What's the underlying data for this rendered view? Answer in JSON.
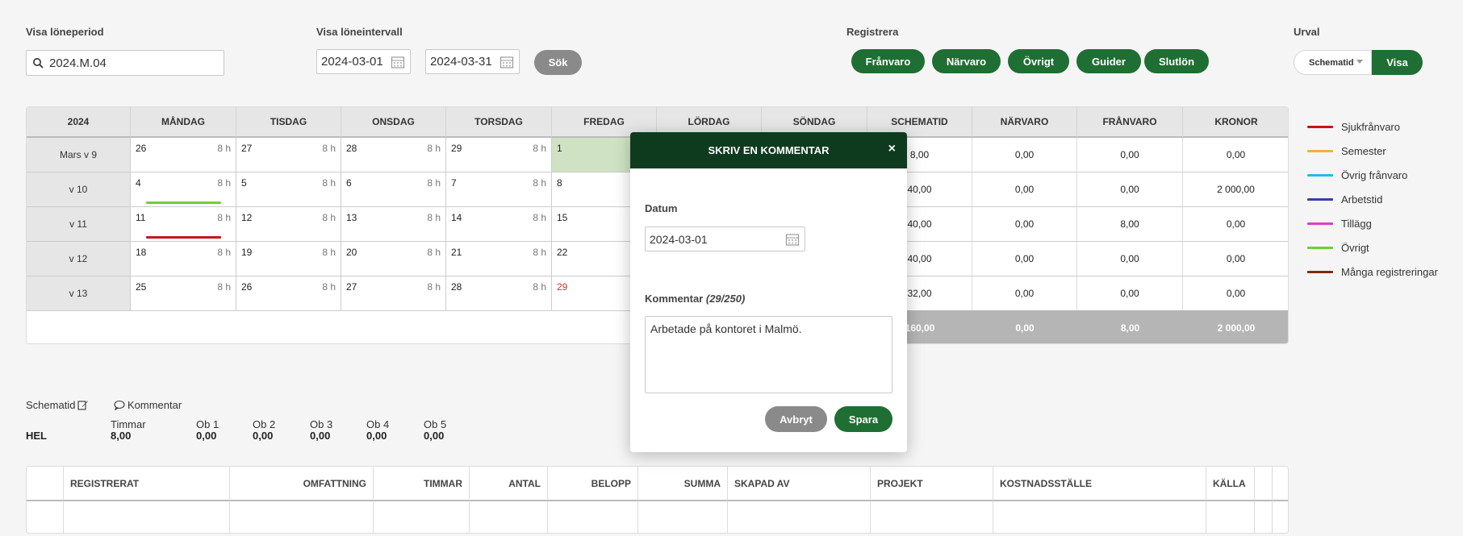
{
  "filters": {
    "loneperiod_label": "Visa löneperiod",
    "loneperiod_value": "2024.M.04",
    "loneintervall_label": "Visa löneintervall",
    "date_from": "2024-03-01",
    "date_to": "2024-03-31",
    "search_label": "Sök"
  },
  "register": {
    "label": "Registrera",
    "buttons": [
      "Frånvaro",
      "Närvaro",
      "Övrigt",
      "Guider",
      "Slutlön"
    ]
  },
  "urval": {
    "label": "Urval",
    "select_value": "Schematid",
    "show_label": "Visa"
  },
  "calendar": {
    "year": "2024",
    "days": [
      "MÅNDAG",
      "TISDAG",
      "ONSDAG",
      "TORSDAG",
      "FREDAG",
      "LÖRDAG",
      "SÖNDAG"
    ],
    "sum_headers": [
      "SCHEMATID",
      "NÄRVARO",
      "FRÅNVARO",
      "KRONOR"
    ],
    "weeks": [
      {
        "label": "Mars v 9",
        "dates": [
          "26",
          "27",
          "28",
          "29",
          "1"
        ],
        "hours": "8 h",
        "schematid": "8,00",
        "narvaro": "0,00",
        "franvaro": "0,00",
        "kronor": "0,00"
      },
      {
        "label": "v 10",
        "dates": [
          "4",
          "5",
          "6",
          "7",
          "8"
        ],
        "hours": "8 h",
        "schematid": "40,00",
        "narvaro": "0,00",
        "franvaro": "0,00",
        "kronor": "2 000,00"
      },
      {
        "label": "v 11",
        "dates": [
          "11",
          "12",
          "13",
          "14",
          "15"
        ],
        "hours": "8 h",
        "schematid": "40,00",
        "narvaro": "0,00",
        "franvaro": "8,00",
        "kronor": "0,00"
      },
      {
        "label": "v 12",
        "dates": [
          "18",
          "19",
          "20",
          "21",
          "22"
        ],
        "hours": "8 h",
        "schematid": "40,00",
        "narvaro": "0,00",
        "franvaro": "0,00",
        "kronor": "0,00"
      },
      {
        "label": "v 13",
        "dates": [
          "25",
          "26",
          "27",
          "28",
          "29"
        ],
        "hours": "8 h",
        "schematid": "32,00",
        "narvaro": "0,00",
        "franvaro": "0,00",
        "kronor": "0,00"
      }
    ],
    "totals": {
      "schematid": "160,00",
      "narvaro": "0,00",
      "franvaro": "8,00",
      "kronor": "2 000,00"
    }
  },
  "legend": [
    {
      "label": "Sjukfrånvaro",
      "color": "#c4161c"
    },
    {
      "label": "Semester",
      "color": "#e9b24a"
    },
    {
      "label": "Övrig frånvaro",
      "color": "#2bb8e0"
    },
    {
      "label": "Arbetstid",
      "color": "#3a3f9e"
    },
    {
      "label": "Tillägg",
      "color": "#d243c8"
    },
    {
      "label": "Övrigt",
      "color": "#6fcf3a"
    },
    {
      "label": "Många registreringar",
      "color": "#7a2e0e"
    }
  ],
  "modal": {
    "title": "SKRIV EN KOMMENTAR",
    "close": "×",
    "datum_label": "Datum",
    "datum_value": "2024-03-01",
    "kommentar_label": "Kommentar",
    "kommentar_count": "(29/250)",
    "kommentar_text": "Arbetade på kontoret i Malmö.",
    "cancel": "Avbryt",
    "save": "Spara"
  },
  "details": {
    "schematid_label": "Schematid",
    "kommentar_label": "Kommentar",
    "row_label": "HEL",
    "columns": [
      {
        "label": "Timmar",
        "value": "8,00"
      },
      {
        "label": "Ob 1",
        "value": "0,00"
      },
      {
        "label": "Ob 2",
        "value": "0,00"
      },
      {
        "label": "Ob 3",
        "value": "0,00"
      },
      {
        "label": "Ob 4",
        "value": "0,00"
      },
      {
        "label": "Ob 5",
        "value": "0,00"
      }
    ]
  },
  "reg_table": {
    "headers": [
      "REGISTRERAT",
      "OMFATTNING",
      "TIMMAR",
      "ANTAL",
      "BELOPP",
      "SUMMA",
      "SKAPAD AV",
      "PROJEKT",
      "KOSTNADSSTÄLLE",
      "KÄLLA"
    ]
  }
}
